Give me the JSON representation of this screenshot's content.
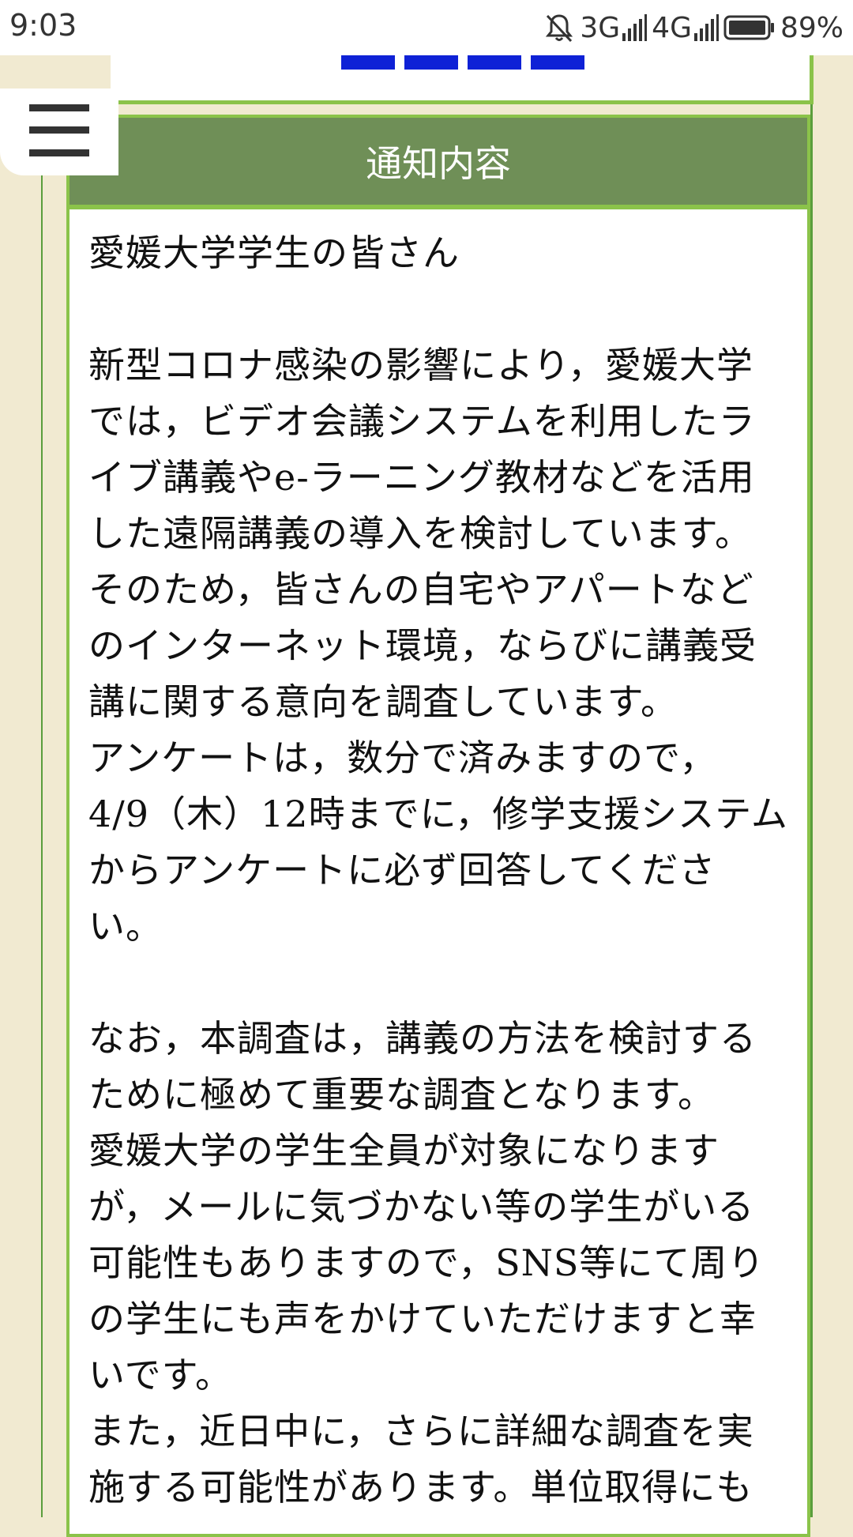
{
  "status_bar": {
    "time": "9:03",
    "network_1": "3G",
    "network_2": "4G",
    "battery_percent": "89%",
    "icons": [
      "bell-off-icon",
      "signal-icon",
      "signal-icon",
      "battery-icon"
    ]
  },
  "header": {
    "title": "通知内容"
  },
  "menu": {
    "icon": "hamburger-menu-icon"
  },
  "content": {
    "greeting": "愛媛大学学生の皆さん",
    "paragraph_1": [
      "新型コロナ感染の影響により，愛媛大学",
      "では，ビデオ会議システムを利用したラ",
      "イブ講義やe-ラーニング教材などを活用",
      "した遠隔講義の導入を検討しています。",
      "そのため，皆さんの自宅やアパートなど",
      "のインターネット環境，ならびに講義受",
      "講に関する意向を調査しています。",
      "アンケートは，数分で済みますので，",
      "4/9（木）12時までに，修学支援システム",
      "からアンケートに必ず回答してくださ",
      "い。"
    ],
    "paragraph_2": [
      "なお，本調査は，講義の方法を検討する",
      "ために極めて重要な調査となります。",
      "愛媛大学の学生全員が対象になります",
      "が，メールに気づかない等の学生がいる",
      "可能性もありますので，SNS等にて周り",
      "の学生にも声をかけていただけますと幸",
      "いです。",
      "また，近日中に，さらに詳細な調査を実",
      "施する可能性があります。単位取得にも"
    ]
  },
  "colors": {
    "background": "#f1ead1",
    "panel_header": "#6f8f57",
    "accent_green": "#8bc34a",
    "nav_blue": "#0e21d6"
  }
}
